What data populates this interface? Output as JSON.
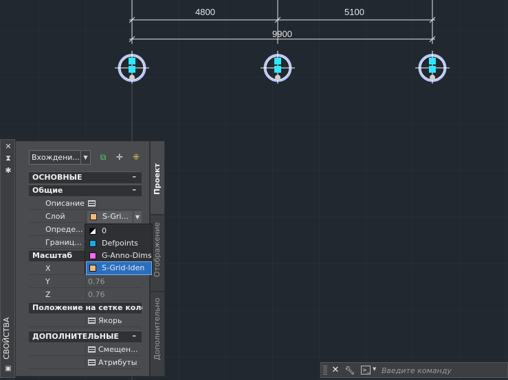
{
  "drawing": {
    "dimensions": [
      "4800",
      "5100",
      "9900"
    ]
  },
  "palette": {
    "title": "СВОЙСТВА",
    "dropdown_value": "Вхождени...",
    "tabs": [
      "Проект",
      "Отображение",
      "Дополнительно"
    ],
    "sections": {
      "basic": "ОСНОВНЫЕ",
      "general": "Общие",
      "scale": "Масштаб",
      "grid_position": "Положение на сетке колонн",
      "additional": "ДОПОЛНИТЕЛЬНЫЕ"
    },
    "rows": {
      "description": "Описание",
      "layer": "Слой",
      "definition": "Опреде...",
      "bounds": "Границ...",
      "x": "X",
      "y": "Y",
      "y_value": "0.76",
      "z": "Z",
      "z_value": "0.76",
      "anchor": "Якорь",
      "offset": "Смещен...",
      "attributes": "Атрибуты"
    },
    "layer_value": "S-Gri...",
    "layer_options": [
      {
        "name": "0",
        "color": "#ffffff"
      },
      {
        "name": "Defpoints",
        "color": "#19a7e6"
      },
      {
        "name": "G-Anno-Dims",
        "color": "#ff66ff"
      },
      {
        "name": "S-Grid-Iden",
        "color": "#f0b97a"
      }
    ]
  },
  "command_line": {
    "placeholder": "Введите команду"
  }
}
